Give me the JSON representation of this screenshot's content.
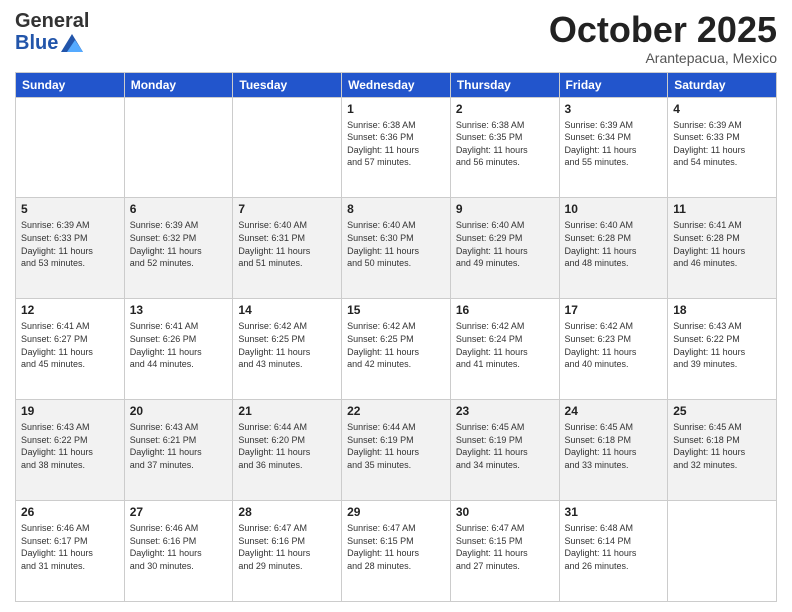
{
  "logo": {
    "general": "General",
    "blue": "Blue"
  },
  "header": {
    "title": "October 2025",
    "subtitle": "Arantepacua, Mexico"
  },
  "weekdays": [
    "Sunday",
    "Monday",
    "Tuesday",
    "Wednesday",
    "Thursday",
    "Friday",
    "Saturday"
  ],
  "weeks": [
    {
      "shaded": false,
      "days": [
        {
          "number": "",
          "info": ""
        },
        {
          "number": "",
          "info": ""
        },
        {
          "number": "",
          "info": ""
        },
        {
          "number": "1",
          "info": "Sunrise: 6:38 AM\nSunset: 6:36 PM\nDaylight: 11 hours\nand 57 minutes."
        },
        {
          "number": "2",
          "info": "Sunrise: 6:38 AM\nSunset: 6:35 PM\nDaylight: 11 hours\nand 56 minutes."
        },
        {
          "number": "3",
          "info": "Sunrise: 6:39 AM\nSunset: 6:34 PM\nDaylight: 11 hours\nand 55 minutes."
        },
        {
          "number": "4",
          "info": "Sunrise: 6:39 AM\nSunset: 6:33 PM\nDaylight: 11 hours\nand 54 minutes."
        }
      ]
    },
    {
      "shaded": true,
      "days": [
        {
          "number": "5",
          "info": "Sunrise: 6:39 AM\nSunset: 6:33 PM\nDaylight: 11 hours\nand 53 minutes."
        },
        {
          "number": "6",
          "info": "Sunrise: 6:39 AM\nSunset: 6:32 PM\nDaylight: 11 hours\nand 52 minutes."
        },
        {
          "number": "7",
          "info": "Sunrise: 6:40 AM\nSunset: 6:31 PM\nDaylight: 11 hours\nand 51 minutes."
        },
        {
          "number": "8",
          "info": "Sunrise: 6:40 AM\nSunset: 6:30 PM\nDaylight: 11 hours\nand 50 minutes."
        },
        {
          "number": "9",
          "info": "Sunrise: 6:40 AM\nSunset: 6:29 PM\nDaylight: 11 hours\nand 49 minutes."
        },
        {
          "number": "10",
          "info": "Sunrise: 6:40 AM\nSunset: 6:28 PM\nDaylight: 11 hours\nand 48 minutes."
        },
        {
          "number": "11",
          "info": "Sunrise: 6:41 AM\nSunset: 6:28 PM\nDaylight: 11 hours\nand 46 minutes."
        }
      ]
    },
    {
      "shaded": false,
      "days": [
        {
          "number": "12",
          "info": "Sunrise: 6:41 AM\nSunset: 6:27 PM\nDaylight: 11 hours\nand 45 minutes."
        },
        {
          "number": "13",
          "info": "Sunrise: 6:41 AM\nSunset: 6:26 PM\nDaylight: 11 hours\nand 44 minutes."
        },
        {
          "number": "14",
          "info": "Sunrise: 6:42 AM\nSunset: 6:25 PM\nDaylight: 11 hours\nand 43 minutes."
        },
        {
          "number": "15",
          "info": "Sunrise: 6:42 AM\nSunset: 6:25 PM\nDaylight: 11 hours\nand 42 minutes."
        },
        {
          "number": "16",
          "info": "Sunrise: 6:42 AM\nSunset: 6:24 PM\nDaylight: 11 hours\nand 41 minutes."
        },
        {
          "number": "17",
          "info": "Sunrise: 6:42 AM\nSunset: 6:23 PM\nDaylight: 11 hours\nand 40 minutes."
        },
        {
          "number": "18",
          "info": "Sunrise: 6:43 AM\nSunset: 6:22 PM\nDaylight: 11 hours\nand 39 minutes."
        }
      ]
    },
    {
      "shaded": true,
      "days": [
        {
          "number": "19",
          "info": "Sunrise: 6:43 AM\nSunset: 6:22 PM\nDaylight: 11 hours\nand 38 minutes."
        },
        {
          "number": "20",
          "info": "Sunrise: 6:43 AM\nSunset: 6:21 PM\nDaylight: 11 hours\nand 37 minutes."
        },
        {
          "number": "21",
          "info": "Sunrise: 6:44 AM\nSunset: 6:20 PM\nDaylight: 11 hours\nand 36 minutes."
        },
        {
          "number": "22",
          "info": "Sunrise: 6:44 AM\nSunset: 6:19 PM\nDaylight: 11 hours\nand 35 minutes."
        },
        {
          "number": "23",
          "info": "Sunrise: 6:45 AM\nSunset: 6:19 PM\nDaylight: 11 hours\nand 34 minutes."
        },
        {
          "number": "24",
          "info": "Sunrise: 6:45 AM\nSunset: 6:18 PM\nDaylight: 11 hours\nand 33 minutes."
        },
        {
          "number": "25",
          "info": "Sunrise: 6:45 AM\nSunset: 6:18 PM\nDaylight: 11 hours\nand 32 minutes."
        }
      ]
    },
    {
      "shaded": false,
      "days": [
        {
          "number": "26",
          "info": "Sunrise: 6:46 AM\nSunset: 6:17 PM\nDaylight: 11 hours\nand 31 minutes."
        },
        {
          "number": "27",
          "info": "Sunrise: 6:46 AM\nSunset: 6:16 PM\nDaylight: 11 hours\nand 30 minutes."
        },
        {
          "number": "28",
          "info": "Sunrise: 6:47 AM\nSunset: 6:16 PM\nDaylight: 11 hours\nand 29 minutes."
        },
        {
          "number": "29",
          "info": "Sunrise: 6:47 AM\nSunset: 6:15 PM\nDaylight: 11 hours\nand 28 minutes."
        },
        {
          "number": "30",
          "info": "Sunrise: 6:47 AM\nSunset: 6:15 PM\nDaylight: 11 hours\nand 27 minutes."
        },
        {
          "number": "31",
          "info": "Sunrise: 6:48 AM\nSunset: 6:14 PM\nDaylight: 11 hours\nand 26 minutes."
        },
        {
          "number": "",
          "info": ""
        }
      ]
    }
  ]
}
